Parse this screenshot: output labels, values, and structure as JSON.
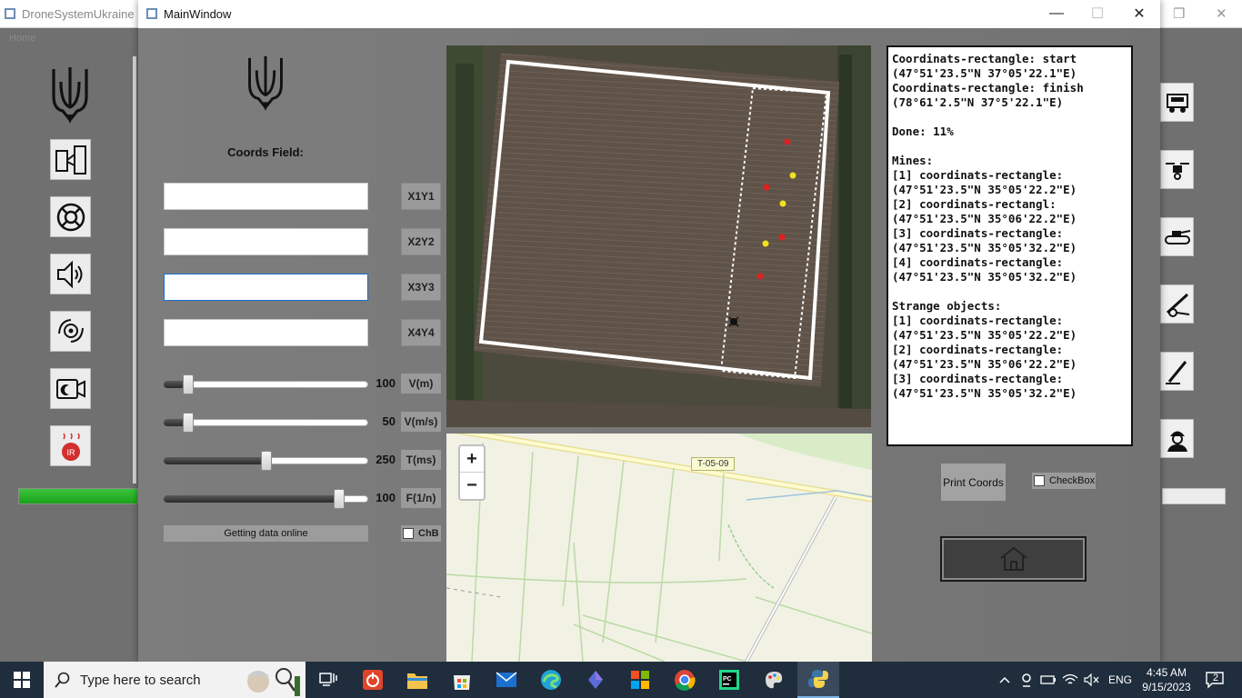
{
  "bg_window": {
    "title": "DroneSystemUkraine",
    "sub_title": "Home"
  },
  "main_window": {
    "title": "MainWindow",
    "coords_field_label": "Coords Field:",
    "coord_inputs": [
      {
        "value": "",
        "button": "X1Y1"
      },
      {
        "value": "",
        "button": "X2Y2"
      },
      {
        "value": "",
        "button": "X3Y3"
      },
      {
        "value": "",
        "button": "X4Y4"
      }
    ],
    "sliders": [
      {
        "value": "100",
        "unit": "V(m)",
        "fraction": 0.1
      },
      {
        "value": "50",
        "unit": "V(m/s)",
        "fraction": 0.1
      },
      {
        "value": "250",
        "unit": "T(ms)",
        "fraction": 0.5
      },
      {
        "value": "100",
        "unit": "F(1/n)",
        "fraction": 0.88
      }
    ],
    "getting_data_label": "Getting data online",
    "chb_label": "ChB",
    "map": {
      "road_label": "T-05-09",
      "zoom_in": "+",
      "zoom_out": "−"
    },
    "info": {
      "lines": [
        "Coordinats-rectangle: start",
        "(47°51'23.5\"N 37°05'22.1\"E)",
        "Coordinats-rectangle: finish",
        "(78°61'2.5\"N 37°5'22.1\"E)",
        "",
        "Done: 11%",
        "",
        "Mines:",
        "[1] coordinats-rectangle:",
        "(47°51'23.5\"N 35°05'22.2\"E)",
        "[2] coordinats-rectangl:  (47°51'23.5\"N 35°06'22.2\"E)",
        "[3] coordinats-rectangle:",
        "(47°51'23.5\"N 35°05'32.2\"E)",
        "[4] coordinats-rectangle:",
        "(47°51'23.5\"N 35°05'32.2\"E)",
        "",
        "Strange objects:",
        "[1] coordinats-rectangle:",
        "(47°51'23.5\"N 35°05'22.2\"E)",
        "[2] coordinats-rectangle:",
        "(47°51'23.5\"N 35°06'22.2\"E)",
        "[3] coordinats-rectangle:",
        "(47°51'23.5\"N 35°05'32.2\"E)"
      ]
    },
    "print_coords_label": "Print Coords",
    "checkbox_label": "CheckBox"
  },
  "taskbar": {
    "search_placeholder": "Type here to search",
    "language": "ENG",
    "time": "4:45 AM",
    "date": "9/15/2023",
    "notification_count": "2"
  },
  "colors": {
    "mine_red": "#e02020",
    "mine_yellow": "#f2e21a",
    "progress_green": "#22b022",
    "taskbar": "#1f2d3d"
  }
}
